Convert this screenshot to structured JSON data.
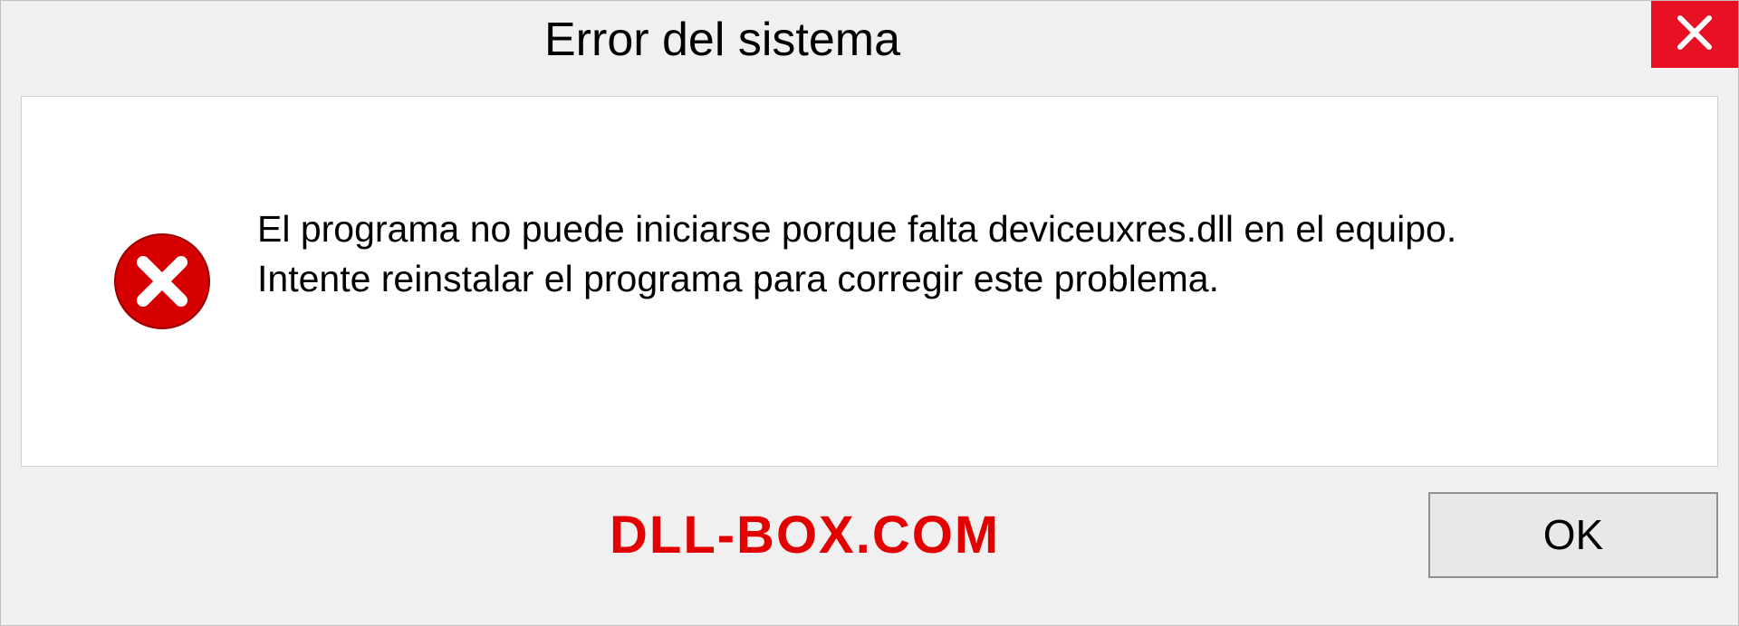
{
  "dialog": {
    "title": "Error del sistema",
    "message_line1": "El programa no puede iniciarse porque falta deviceuxres.dll en el equipo.",
    "message_line2": "Intente reinstalar el programa para corregir este problema.",
    "ok_label": "OK"
  },
  "watermark": "DLL-BOX.COM",
  "colors": {
    "close_bg": "#e81123",
    "error_icon": "#d60000",
    "watermark": "#e20000"
  }
}
